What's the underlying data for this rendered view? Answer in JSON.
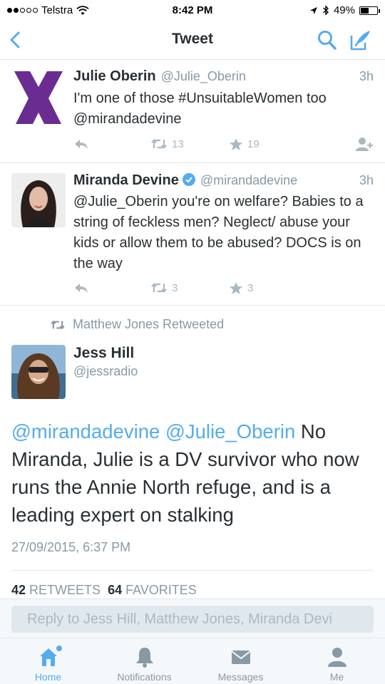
{
  "status_bar": {
    "carrier": "Telstra",
    "time": "8:42 PM",
    "battery": "49%",
    "battery_fraction": 0.49
  },
  "nav": {
    "title": "Tweet",
    "icons": [
      "back-chevron-icon",
      "search-icon",
      "compose-icon"
    ]
  },
  "tweets": [
    {
      "name": "Julie Oberin",
      "handle": "@Julie_Oberin",
      "time": "3h",
      "text": "I'm one of those #UnsuitableWomen too @mirandadevine",
      "retweets": "13",
      "favorites": "19",
      "avatar_color": "#6a2c91"
    },
    {
      "name": "Miranda Devine",
      "handle": "@mirandadevine",
      "time": "3h",
      "text": "@Julie_Oberin you're on welfare? Babies to a string of feckless men? Neglect/ abuse your kids or allow them to be abused? DOCS is on the way",
      "retweets": "3",
      "favorites": "3",
      "verified": true
    }
  ],
  "retweet_context": "Matthew Jones Retweeted",
  "main_tweet": {
    "name": "Jess Hill",
    "handle": "@jessradio",
    "mention1": "@mirandadevine",
    "mention2": "@Julie_Oberin",
    "text": "No Miranda, Julie is a DV survivor who now runs the Annie North refuge, and is a leading expert on stalking",
    "date": "27/09/2015, 6:37 PM",
    "retweet_count": "42",
    "retweet_label": "RETWEETS",
    "favorite_count": "64",
    "favorite_label": "FAVORITES"
  },
  "reply_placeholder": "Reply to Jess Hill, Matthew Jones, Miranda Devi",
  "tabs": [
    {
      "label": "Home",
      "icon": "home-icon",
      "active": true
    },
    {
      "label": "Notifications",
      "icon": "bell-icon"
    },
    {
      "label": "Messages",
      "icon": "envelope-icon"
    },
    {
      "label": "Me",
      "icon": "person-icon"
    }
  ],
  "colors": {
    "accent": "#55acee",
    "muted": "#8899a6",
    "text": "#292f33"
  }
}
